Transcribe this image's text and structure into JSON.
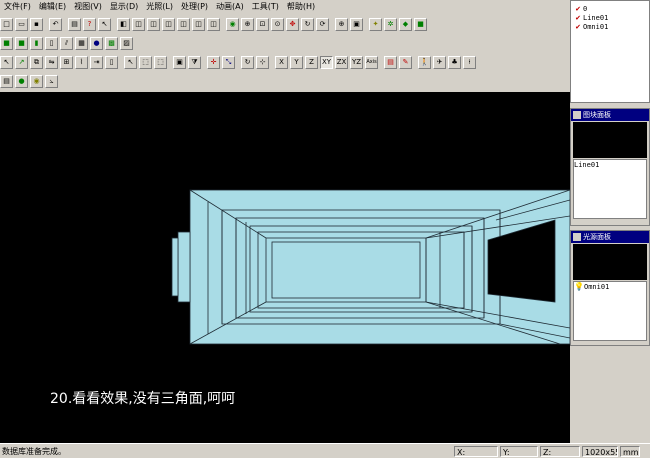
{
  "menu": [
    "文件(F)",
    "编辑(E)",
    "视图(V)",
    "显示(D)",
    "光照(L)",
    "处理(P)",
    "动画(A)",
    "工具(T)",
    "帮助(H)"
  ],
  "axis_buttons": [
    "X",
    "Y",
    "Z",
    "XY",
    "ZX",
    "YZ",
    "Axis"
  ],
  "layers_panel": {
    "items": [
      {
        "label": "0"
      },
      {
        "label": "Line01"
      },
      {
        "label": "Omni01"
      }
    ]
  },
  "graphics_panel": {
    "title": "图块面板",
    "items": [
      {
        "label": "Line01"
      }
    ]
  },
  "lights_panel": {
    "title": "光源面板",
    "items": [
      {
        "label": "Omni01"
      }
    ]
  },
  "caption": "20.看看效果,没有三角面,呵呵",
  "status": {
    "message": "数据库准备完成。",
    "x_label": "X:",
    "y_label": "Y:",
    "z_label": "Z:",
    "resolution": "1020x558",
    "unit": "mm"
  },
  "colors": {
    "viewport_bg": "#000000",
    "model_fill": "#a9dce6",
    "model_line": "#1e2a33",
    "title_bar": "#000080"
  }
}
